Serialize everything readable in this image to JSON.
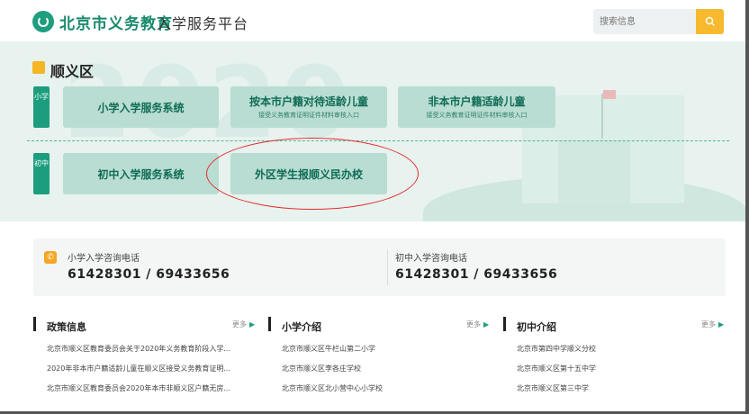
{
  "header": {
    "brand": "北京市义务教育",
    "brand_sub": "入学服务平台",
    "search_placeholder": "搜索信息"
  },
  "hero": {
    "bg_text": "2020",
    "district": "顺义区",
    "tags": {
      "primary": "小学",
      "middle": "初中"
    },
    "buttons": [
      {
        "title": "小学入学服务系统",
        "sub": ""
      },
      {
        "title": "按本市户籍对待适龄儿童",
        "sub": "接受义务教育证明证件材料审核入口"
      },
      {
        "title": "非本市户籍适龄儿童",
        "sub": "接受义务教育证明证件材料审核入口"
      },
      {
        "title": "初中入学服务系统",
        "sub": ""
      },
      {
        "title": "外区学生报顺义民办校",
        "sub": ""
      }
    ]
  },
  "phones": [
    {
      "label": "小学入学咨询电话",
      "number": "61428301 / 69433656"
    },
    {
      "label": "初中入学咨询电话",
      "number": "61428301 / 69433656"
    }
  ],
  "columns": [
    {
      "title": "政策信息",
      "more": "更多",
      "items": [
        "北京市顺义区教育委员会关于2020年义务教育阶段入学...",
        "2020年非本市户籍适龄儿童在顺义区接受义务教育证明...",
        "北京市顺义区教育委员会2020年本市非顺义区户籍无房..."
      ]
    },
    {
      "title": "小学介绍",
      "more": "更多",
      "items": [
        "北京市顺义区牛栏山第二小学",
        "北京市顺义区李各庄学校",
        "北京市顺义区北小营中心小学校"
      ]
    },
    {
      "title": "初中介绍",
      "more": "更多",
      "items": [
        "北京市第四中学顺义分校",
        "北京市顺义区第十五中学",
        "北京市顺义区第三中学"
      ]
    }
  ],
  "colors": {
    "brand_green": "#1c9e7e",
    "button_bg": "#b9ddd3",
    "search_button": "#f7b92e",
    "highlight_oval": "#e32b2b"
  }
}
